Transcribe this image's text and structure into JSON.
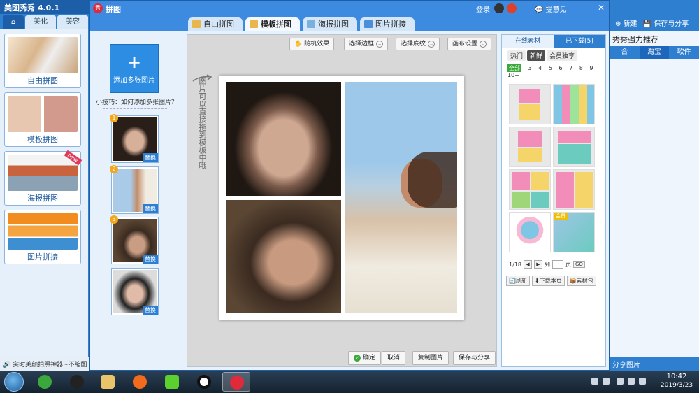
{
  "main_app": {
    "title": "美图秀秀 4.0.1",
    "tabs": [
      "美化",
      "美容"
    ],
    "modes": [
      "自由拼图",
      "模板拼图",
      "海报拼图",
      "图片拼接"
    ],
    "new_badge": "new",
    "bottom_tip": "实时美颜拍照神器~不缩图"
  },
  "right_bg": {
    "new_label": "新建",
    "save_label": "保存与分享",
    "title": "秀秀强力推荐",
    "cats": [
      "合",
      "淘宝",
      "软件"
    ],
    "footer": "分享图片"
  },
  "collage": {
    "title": "拼图",
    "login": "登录",
    "feedback": "提意见",
    "tabs": [
      "自由拼图",
      "模板拼图",
      "海报拼图",
      "图片拼接"
    ],
    "active_tab": "模板拼图",
    "add_button": "添加多张图片",
    "tip": "小技巧：如何添加多张图片？",
    "replace_label": "替换",
    "photo_numbers": [
      "1",
      "2",
      "3"
    ],
    "vertical_hint": "图片可以直接拖到模板中哦",
    "toolbar": {
      "random": "随机效果",
      "border": "选择边框",
      "texture": "选择底纹",
      "canvas": "画布设置"
    },
    "bottom": {
      "ok": "确定",
      "cancel": "取消",
      "copy": "复制图片",
      "save": "保存与分享"
    }
  },
  "materials": {
    "tabs": [
      "在线素材",
      "已下载[5]"
    ],
    "subtabs": [
      "热门",
      "新鲜",
      "会员独享"
    ],
    "active_subtab": "新鲜",
    "counts": [
      "全部",
      "3",
      "4",
      "5",
      "6",
      "7",
      "8",
      "9",
      "10+"
    ],
    "page": "1/18",
    "goto_label": "到",
    "page_unit": "页",
    "go": "GO",
    "vip_badge": "会员",
    "actions": [
      "刷新",
      "下载本页",
      "素材包"
    ]
  },
  "taskbar": {
    "time": "10:42",
    "date": "2019/3/23"
  },
  "colors": {
    "accent": "#2f7fd0",
    "window": "#3d8be0",
    "panel": "#e7f1fb"
  }
}
